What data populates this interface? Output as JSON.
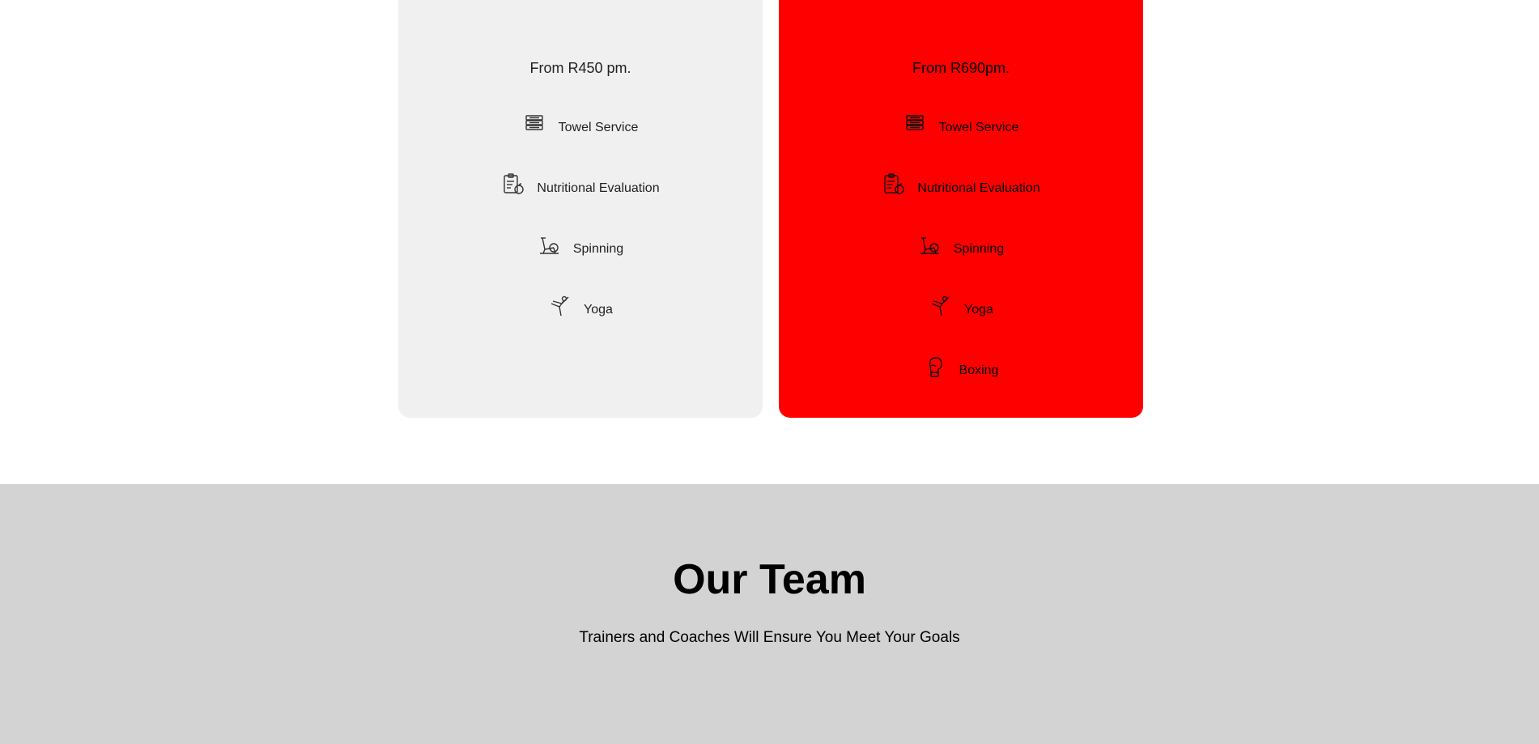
{
  "pricing": {
    "basic": {
      "price": "From R450 pm.",
      "features": [
        {
          "label": "Towel Service",
          "icon": "towel-stack-icon"
        },
        {
          "label": "Nutritional Evaluation",
          "icon": "clipboard-apple-icon"
        },
        {
          "label": "Spinning",
          "icon": "exercise-bike-icon"
        },
        {
          "label": "Yoga",
          "icon": "yoga-pose-icon"
        }
      ]
    },
    "premium": {
      "price": "From R690pm.",
      "features": [
        {
          "label": "Towel Service",
          "icon": "towel-stack-icon"
        },
        {
          "label": "Nutritional Evaluation",
          "icon": "clipboard-apple-icon"
        },
        {
          "label": "Spinning",
          "icon": "exercise-bike-icon"
        },
        {
          "label": "Yoga",
          "icon": "yoga-pose-icon"
        },
        {
          "label": "Boxing",
          "icon": "boxing-glove-icon"
        }
      ]
    }
  },
  "team": {
    "title": "Our Team",
    "subtitle": "Trainers and Coaches Will Ensure You Meet Your Goals"
  },
  "colors": {
    "basic_card": "#f0f0f0",
    "premium_card": "#ff0000",
    "team_bg": "#d3d3d3"
  }
}
